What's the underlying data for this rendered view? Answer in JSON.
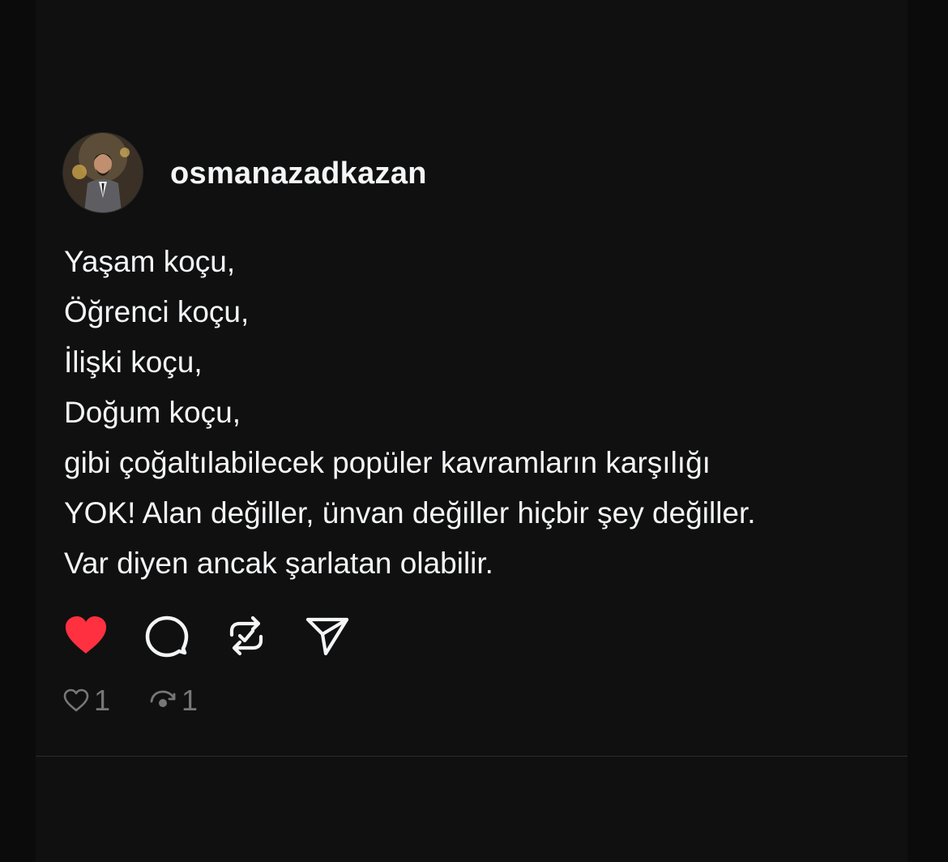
{
  "post": {
    "author": {
      "username": "osmanazadkazan",
      "avatar_icon": "profile-photo"
    },
    "lines": [
      "Yaşam koçu,",
      "Öğrenci koçu,",
      "İlişki koçu,",
      "Doğum koçu,",
      "gibi çoğaltılabilecek popüler kavramların karşılığı",
      "YOK! Alan değiller, ünvan değiller hiçbir şey değiller.",
      "Var diyen ancak şarlatan olabilir."
    ],
    "actions": {
      "like_icon": "heart-filled-icon",
      "liked": true,
      "comment_icon": "comment-bubble-icon",
      "repost_icon": "repost-icon",
      "share_icon": "send-icon"
    },
    "stats": {
      "likes": "1",
      "reposts": "1"
    }
  },
  "colors": {
    "background": "#101010",
    "text": "#f3f5f7",
    "like_red": "#ff3040",
    "muted": "#777777"
  }
}
